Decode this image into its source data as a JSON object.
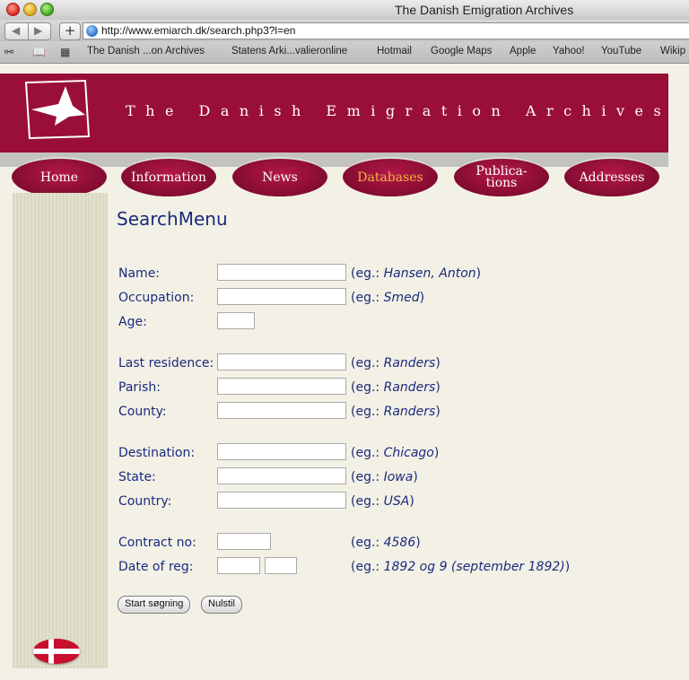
{
  "window": {
    "title": "The Danish Emigration Archives"
  },
  "toolbar": {
    "back_icon": "back-arrow-icon",
    "forward_icon": "forward-arrow-icon",
    "add_label": "+",
    "url": "http://www.emiarch.dk/search.php3?l=en"
  },
  "bookmarks": {
    "items": [
      "The Danish ...on Archives",
      "Statens Arki...valieronline",
      "Hotmail",
      "Google Maps",
      "Apple",
      "Yahoo!",
      "YouTube",
      "Wikip"
    ]
  },
  "site": {
    "title": "The Danish Emigration Archives"
  },
  "nav": {
    "items": [
      {
        "label": "Home"
      },
      {
        "label": "Information"
      },
      {
        "label": "News"
      },
      {
        "label": "Databases",
        "active": true
      },
      {
        "label": "Publica-\ntions"
      },
      {
        "label": "Addresses"
      }
    ]
  },
  "search": {
    "heading": "SearchMenu",
    "eg_prefix": "(eg.: ",
    "fields": {
      "name": {
        "label": "Name:",
        "example": "Hansen, Anton"
      },
      "occupation": {
        "label": "Occupation:",
        "example": "Smed"
      },
      "age": {
        "label": "Age:"
      },
      "last_residence": {
        "label": "Last residence:",
        "example": "Randers"
      },
      "parish": {
        "label": "Parish:",
        "example": "Randers"
      },
      "county": {
        "label": "County:",
        "example": "Randers"
      },
      "destination": {
        "label": "Destination:",
        "example": "Chicago"
      },
      "state": {
        "label": "State:",
        "example": "Iowa"
      },
      "country": {
        "label": "Country:",
        "example": "USA"
      },
      "contract": {
        "label": "Contract no:",
        "example": "4586"
      },
      "date": {
        "label": "Date of reg:",
        "example": "1892 og 9 (september 1892)"
      }
    },
    "submit_label": "Start søgning",
    "reset_label": "Nulstil"
  },
  "colors": {
    "banner": "#9a0f38",
    "text": "#1a2a7d",
    "active_nav": "#f2b33d"
  }
}
